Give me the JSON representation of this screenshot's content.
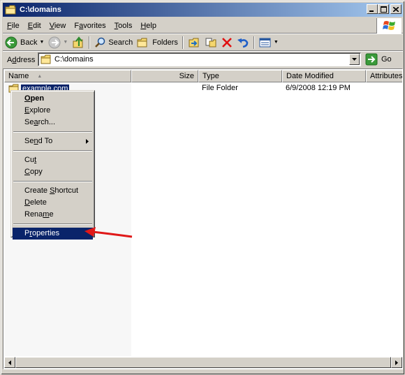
{
  "window": {
    "title": "C:\\domains",
    "caption_buttons": {
      "minimize": "_",
      "maximize": "□",
      "close": "×"
    }
  },
  "menubar": {
    "items": [
      {
        "label": "File",
        "accel": "F",
        "rest": "ile"
      },
      {
        "label": "Edit",
        "accel": "E",
        "rest": "dit"
      },
      {
        "label": "View",
        "accel": "V",
        "rest": "iew"
      },
      {
        "label": "Favorites",
        "accel": "a",
        "pre": "F",
        "rest": "vorites"
      },
      {
        "label": "Tools",
        "accel": "T",
        "rest": "ools"
      },
      {
        "label": "Help",
        "accel": "H",
        "rest": "elp"
      }
    ]
  },
  "toolbar": {
    "back_label": "Back",
    "search_label": "Search",
    "folders_label": "Folders",
    "dropdown_glyph": "▼"
  },
  "addressbar": {
    "label_accel": "d",
    "label_pre": "A",
    "label_rest": "dress",
    "value": "C:\\domains",
    "go_label": "Go"
  },
  "listview": {
    "columns": [
      {
        "label": "Name",
        "sorted": true
      },
      {
        "label": "Size"
      },
      {
        "label": "Type"
      },
      {
        "label": "Date Modified"
      },
      {
        "label": "Attributes"
      }
    ],
    "rows": [
      {
        "name": "example.com",
        "size": "",
        "type": "File Folder",
        "date_modified": "6/9/2008 12:19 PM",
        "attributes": ""
      }
    ]
  },
  "context_menu": {
    "items": [
      {
        "label": "Open",
        "pre": "",
        "accel": "O",
        "rest": "pen",
        "bold": true
      },
      {
        "label": "Explore",
        "pre": "",
        "accel": "E",
        "rest": "xplore"
      },
      {
        "label": "Search...",
        "pre": "Se",
        "accel": "a",
        "rest": "rch..."
      },
      {
        "separator": true
      },
      {
        "label": "Send To",
        "pre": "Se",
        "accel": "n",
        "rest": "d To",
        "submenu": true
      },
      {
        "separator": true
      },
      {
        "label": "Cut",
        "pre": "Cu",
        "accel": "t",
        "rest": ""
      },
      {
        "label": "Copy",
        "pre": "",
        "accel": "C",
        "rest": "opy"
      },
      {
        "separator": true
      },
      {
        "label": "Create Shortcut",
        "pre": "Create ",
        "accel": "S",
        "rest": "hortcut"
      },
      {
        "label": "Delete",
        "pre": "",
        "accel": "D",
        "rest": "elete"
      },
      {
        "label": "Rename",
        "pre": "Rena",
        "accel": "m",
        "rest": "e"
      },
      {
        "separator": true
      },
      {
        "label": "Properties",
        "pre": "P",
        "accel": "r",
        "rest": "operties",
        "highlighted": true
      }
    ]
  },
  "colors": {
    "title_start": "#0a246a",
    "title_end": "#a6caf0",
    "selection": "#0a246a",
    "chrome": "#d4d0c8",
    "annotation_arrow": "#e01818"
  }
}
